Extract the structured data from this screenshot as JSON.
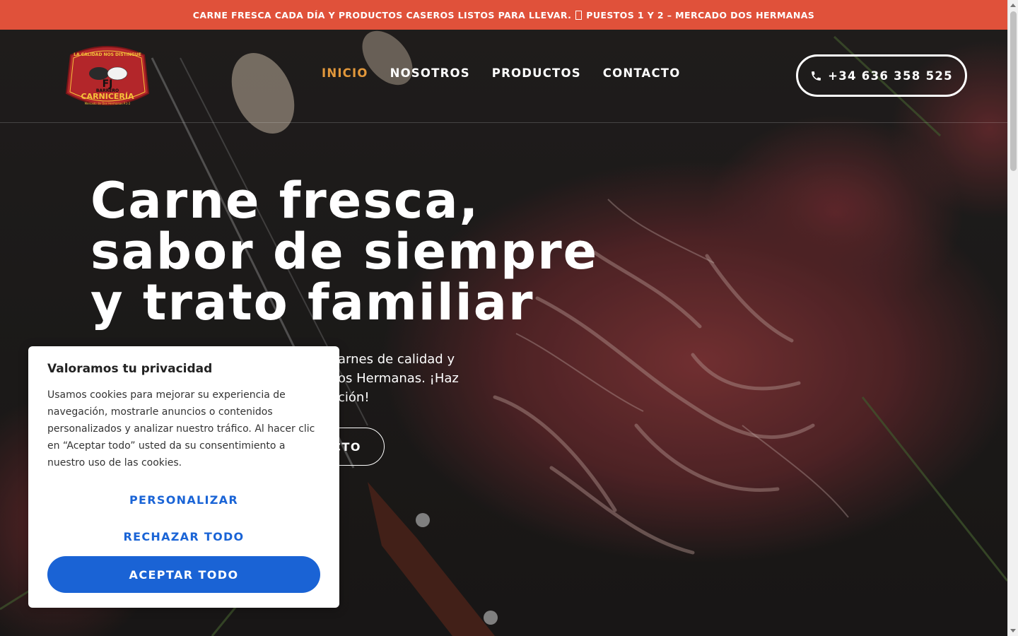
{
  "announcement": {
    "text_before": "CARNE FRESCA CADA DÍA Y PRODUCTOS CASEROS LISTOS PARA LLEVAR.",
    "text_after": "PUESTOS 1 Y 2 – MERCADO DOS HERMANAS",
    "separator_icon": "missing-glyph-box"
  },
  "header": {
    "logo": {
      "top_text": "LA CALIDAD NOS DISTINGUE",
      "monogram": "FJ",
      "name": "BARRERO",
      "main_text": "CARNICERÍA",
      "bottom_text": "Mercado de Dos Hermanas P.1-2",
      "colors": {
        "background": "#b3262a",
        "text": "#f5c23a",
        "border": "#7a1518"
      }
    },
    "nav": [
      {
        "label": "INICIO",
        "active": true
      },
      {
        "label": "NOSOTROS",
        "active": false
      },
      {
        "label": "PRODUCTOS",
        "active": false
      },
      {
        "label": "CONTACTO",
        "active": false
      }
    ],
    "phone": {
      "icon": "phone-icon",
      "number": "+34 636 358 525"
    }
  },
  "hero": {
    "title_lines": [
      "Carne fresca,",
      "sabor de siempre",
      "y trato familiar"
    ],
    "subtitle_visible": "arnes de calidad y\nos Hermanas. ¡Haz\nción!",
    "cta_label_visible": "CTO"
  },
  "cookie_banner": {
    "title": "Valoramos tu privacidad",
    "body": "Usamos cookies para mejorar su experiencia de navegación, mostrarle anuncios o contenidos personalizados y analizar nuestro tráfico. Al hacer clic en “Aceptar todo” usted da su consentimiento a nuestro uso de las cookies.",
    "customize_label": "PERSONALIZAR",
    "reject_label": "RECHAZAR TODO",
    "accept_label": "ACEPTAR TODO"
  },
  "colors": {
    "topbar": "#e0513a",
    "nav_active": "#e2983b",
    "cookie_primary": "#1a63d5",
    "cookie_link": "#1a64d6"
  }
}
